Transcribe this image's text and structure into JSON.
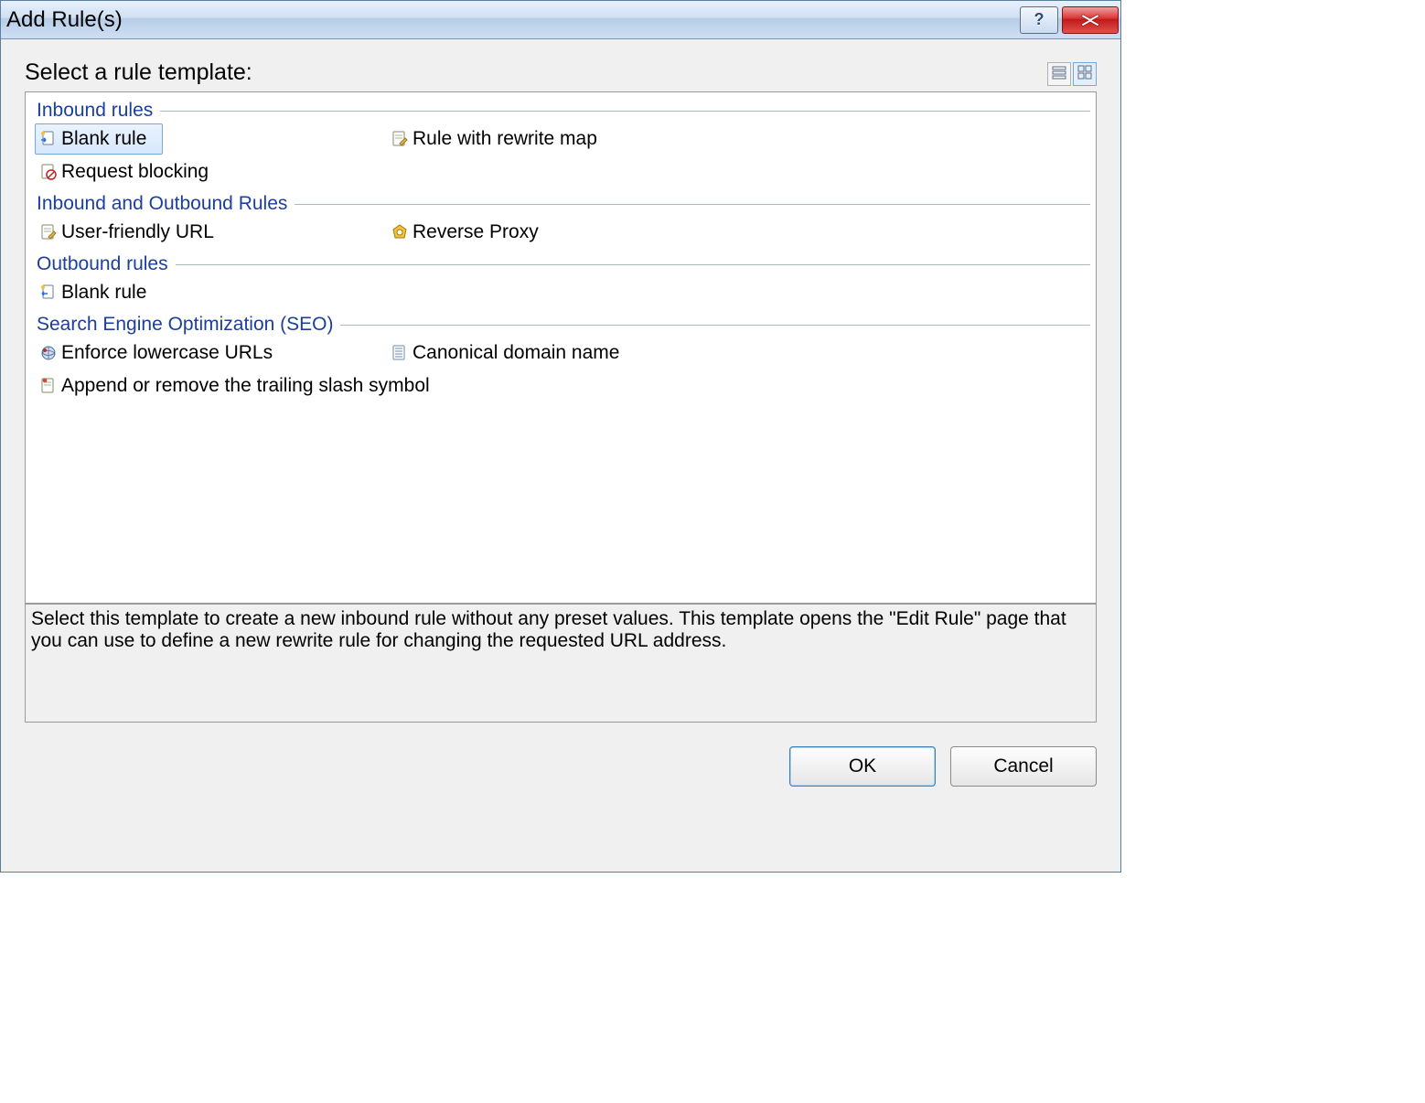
{
  "window": {
    "title": "Add Rule(s)"
  },
  "header": {
    "label": "Select a rule template:"
  },
  "groups": [
    {
      "title": "Inbound rules",
      "items": [
        {
          "label": "Blank rule",
          "icon": "doc-in-icon",
          "selected": true
        },
        {
          "label": "Rule with rewrite map",
          "icon": "doc-edit-icon"
        },
        {
          "label": "Request blocking",
          "icon": "doc-block-icon"
        }
      ]
    },
    {
      "title": "Inbound and Outbound Rules",
      "items": [
        {
          "label": "User-friendly URL",
          "icon": "doc-edit-icon"
        },
        {
          "label": "Reverse Proxy",
          "icon": "proxy-icon"
        }
      ]
    },
    {
      "title": "Outbound rules",
      "items": [
        {
          "label": "Blank rule",
          "icon": "doc-out-icon"
        }
      ]
    },
    {
      "title": "Search Engine Optimization (SEO)",
      "items": [
        {
          "label": "Enforce lowercase URLs",
          "icon": "globe-icon"
        },
        {
          "label": "Canonical domain name",
          "icon": "doc-list-icon"
        },
        {
          "label": "Append or remove the trailing slash symbol",
          "icon": "doc-pin-icon"
        }
      ]
    }
  ],
  "description": "Select this template to create a new inbound rule without any preset values. This template opens the \"Edit Rule\" page that you can use to define a new rewrite rule for changing the requested URL address.",
  "buttons": {
    "ok": "OK",
    "cancel": "Cancel"
  }
}
